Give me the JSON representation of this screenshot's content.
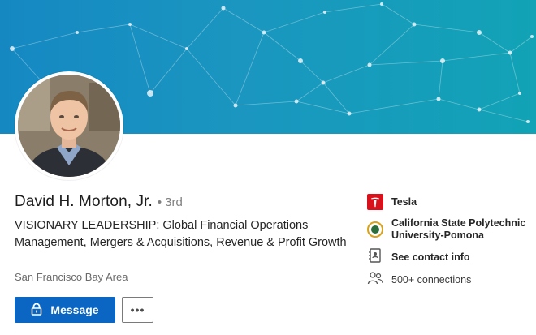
{
  "profile": {
    "name": "David H. Morton, Jr.",
    "degree_separator": "•",
    "degree": "3rd",
    "headline": "VISIONARY LEADERSHIP: Global Financial Operations Management, Mergers & Acquisitions, Revenue & Profit Growth",
    "location": "San Francisco Bay Area"
  },
  "actions": {
    "message_label": "Message",
    "more_label": "•••"
  },
  "sidebar": {
    "company": "Tesla",
    "school_line1": "California State Polytechnic",
    "school_line2": "University-Pomona",
    "contact_info": "See contact info",
    "connections": "500+ connections"
  },
  "colors": {
    "primary_button": "#0a66c2",
    "tesla_red": "#d8121c",
    "banner_left": "#1588c2",
    "banner_right": "#12a3b6"
  },
  "icons": {
    "message_button": "lock-icon",
    "company": "tesla-logo",
    "school": "university-seal-icon",
    "contact": "contact-card-icon",
    "connections": "people-icon"
  }
}
